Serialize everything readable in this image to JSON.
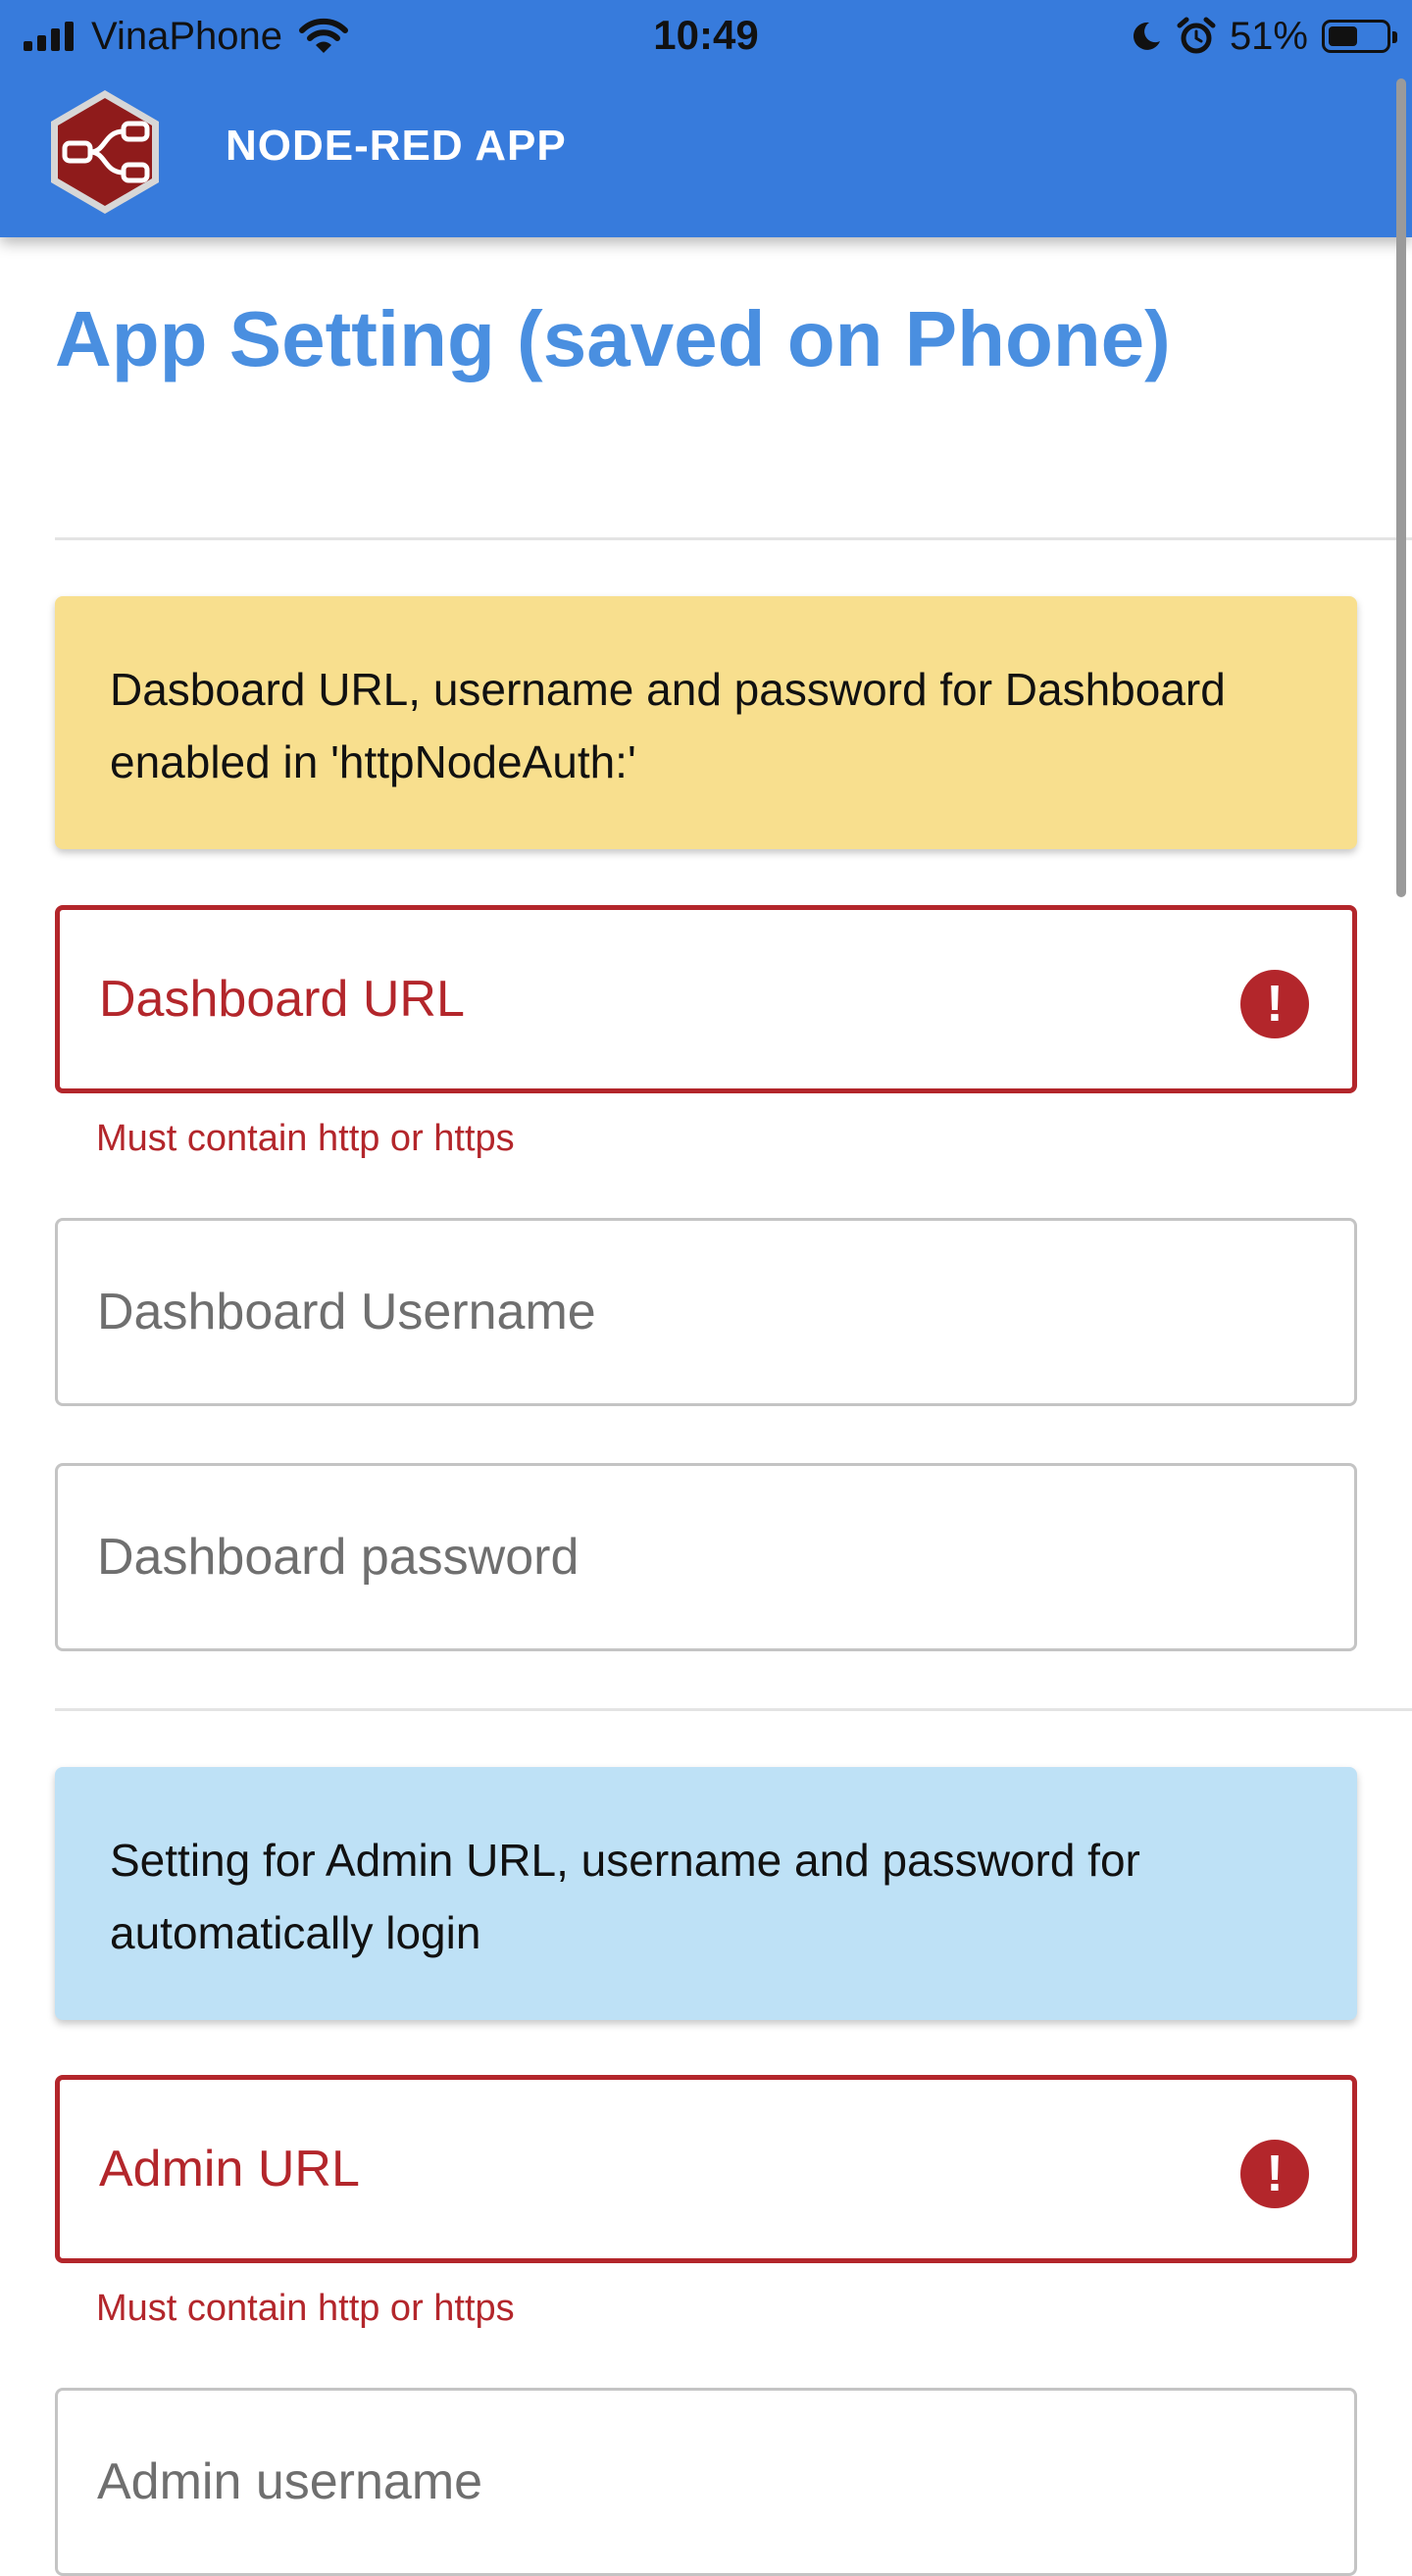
{
  "status_bar": {
    "carrier": "VinaPhone",
    "time": "10:49",
    "battery_percent": "51%",
    "battery_level": 0.51,
    "icons": [
      "signal-icon",
      "wifi-icon",
      "moon-icon",
      "alarm-icon",
      "battery-icon"
    ]
  },
  "app_bar": {
    "title": "NODE-RED APP",
    "background": "#377bdc",
    "logo_icon": "node-red-logo-icon"
  },
  "page": {
    "title": "App Setting (saved on Phone)",
    "title_color": "#4a8fe0"
  },
  "dashboard_section": {
    "notice": "Dasboard URL, username and password for Dashboard enabled in 'httpNodeAuth:'",
    "notice_color": "#f8df8e",
    "url_field": {
      "placeholder": "Dashboard URL",
      "value": "",
      "error": "Must contain http or https"
    },
    "username_field": {
      "placeholder": "Dashboard Username",
      "value": ""
    },
    "password_field": {
      "placeholder": "Dashboard password",
      "value": ""
    }
  },
  "admin_section": {
    "notice": "Setting for Admin URL, username and password for automatically login",
    "notice_color": "#bee1f6",
    "url_field": {
      "placeholder": "Admin URL",
      "value": "",
      "error": "Must contain http or https"
    },
    "username_field": {
      "placeholder": "Admin username",
      "value": ""
    }
  },
  "error_color": "#b3262b",
  "error_icon_glyph": "!"
}
